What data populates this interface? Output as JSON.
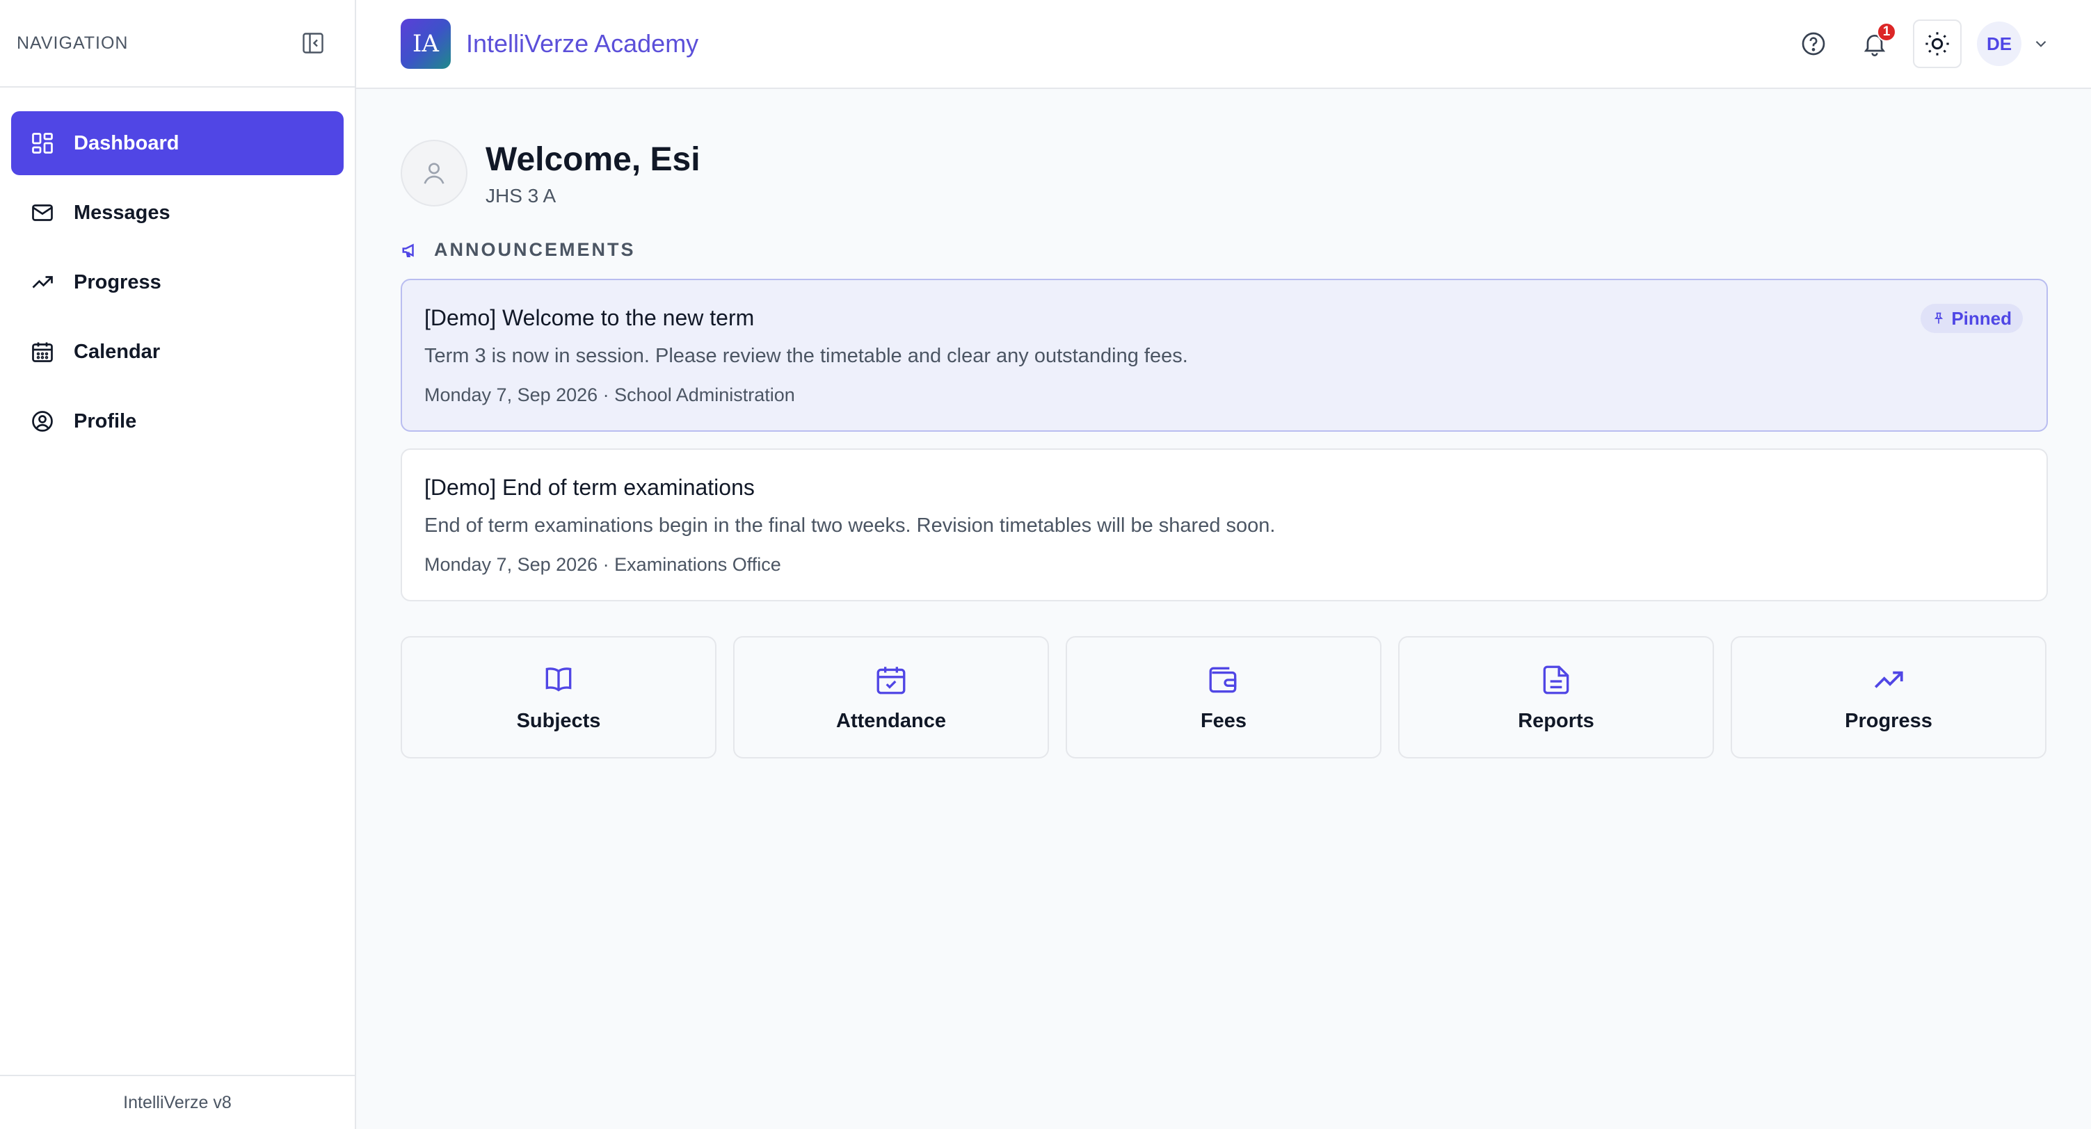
{
  "sidebar": {
    "title": "NAVIGATION",
    "items": [
      {
        "label": "Dashboard",
        "icon": "dashboard-icon",
        "active": true
      },
      {
        "label": "Messages",
        "icon": "mail-icon"
      },
      {
        "label": "Progress",
        "icon": "trending-up-icon"
      },
      {
        "label": "Calendar",
        "icon": "calendar-icon"
      },
      {
        "label": "Profile",
        "icon": "user-circle-icon"
      }
    ],
    "footer": "IntelliVerze v8"
  },
  "header": {
    "logo_text": "IA",
    "app_name": "IntelliVerze Academy",
    "notification_count": "1",
    "user_initials": "DE"
  },
  "welcome": {
    "greeting": "Welcome, Esi",
    "class": "JHS 3 A"
  },
  "announcements": {
    "title": "ANNOUNCEMENTS",
    "items": [
      {
        "title": "[Demo] Welcome to the new term",
        "body": "Term 3 is now in session. Please review the timetable and clear any outstanding fees.",
        "meta": "Monday 7, Sep 2026 · School Administration",
        "pinned_label": "Pinned"
      },
      {
        "title": "[Demo] End of term examinations",
        "body": "End of term examinations begin in the final two weeks. Revision timetables will be shared soon.",
        "meta": "Monday 7, Sep 2026 · Examinations Office"
      }
    ]
  },
  "quick_links": [
    {
      "label": "Subjects",
      "icon": "book-icon"
    },
    {
      "label": "Attendance",
      "icon": "calendar-check-icon"
    },
    {
      "label": "Fees",
      "icon": "wallet-icon"
    },
    {
      "label": "Reports",
      "icon": "document-icon"
    },
    {
      "label": "Progress",
      "icon": "trending-up-icon"
    }
  ],
  "colors": {
    "accent": "#5046e5",
    "brand_text": "#5b4fd9",
    "pinned_bg": "#eef0fb",
    "badge": "#dc2626"
  }
}
